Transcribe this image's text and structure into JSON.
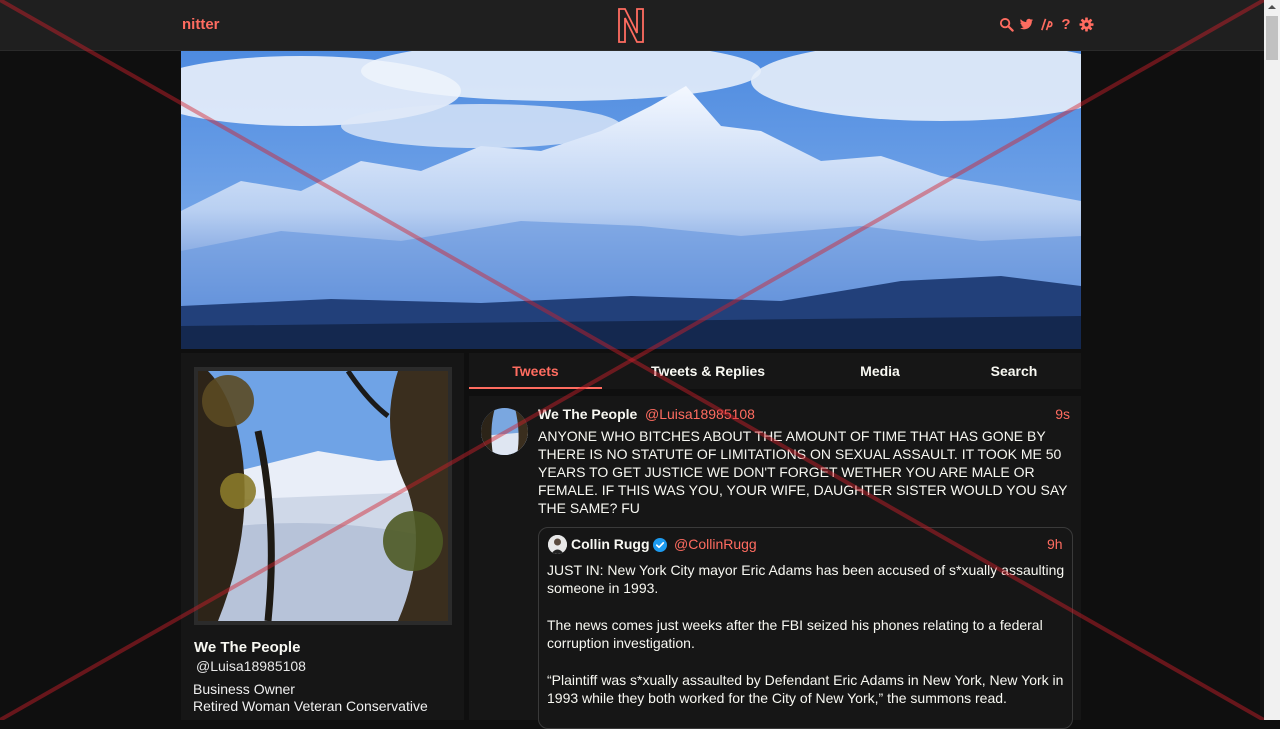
{
  "header": {
    "brand": "nitter",
    "icons": [
      "search-icon",
      "twitter-icon",
      "rss-icon",
      "help-icon",
      "gear-icon"
    ],
    "help_glyph": "?",
    "accent": "#ff6c60"
  },
  "profile": {
    "fullname": "We The People",
    "username": "@Luisa18985108",
    "bio_lines": [
      "Business Owner",
      "Retired Woman Veteran Conservative"
    ]
  },
  "tabs": [
    {
      "label": "Tweets",
      "active": true
    },
    {
      "label": "Tweets & Replies",
      "active": false
    },
    {
      "label": "Media",
      "active": false
    },
    {
      "label": "Search",
      "active": false
    }
  ],
  "tweet": {
    "fullname": "We The People",
    "username": "@Luisa18985108",
    "date": "9s",
    "text": "ANYONE WHO BITCHES ABOUT THE AMOUNT OF TIME THAT HAS GONE BY THERE IS NO STATUTE OF LIMITATIONS ON SEXUAL ASSAULT. IT TOOK ME 50 YEARS TO GET JUSTICE WE DON'T FORGET WETHER YOU ARE MALE OR FEMALE. IF THIS WAS YOU, YOUR WIFE, DAUGHTER SISTER WOULD YOU SAY THE SAME? FU",
    "quote": {
      "fullname": "Collin Rugg",
      "username": "@CollinRugg",
      "date": "9h",
      "paragraphs": [
        "JUST IN: New York City mayor Eric Adams has been accused of s*xually assaulting someone in 1993.",
        "The news comes just weeks after the FBI seized his phones relating to a federal corruption investigation.",
        "“Plaintiff was s*xually assaulted by Defendant Eric Adams in New York, New York in 1993 while they both worked for the City of New York,” the summons read."
      ]
    }
  }
}
